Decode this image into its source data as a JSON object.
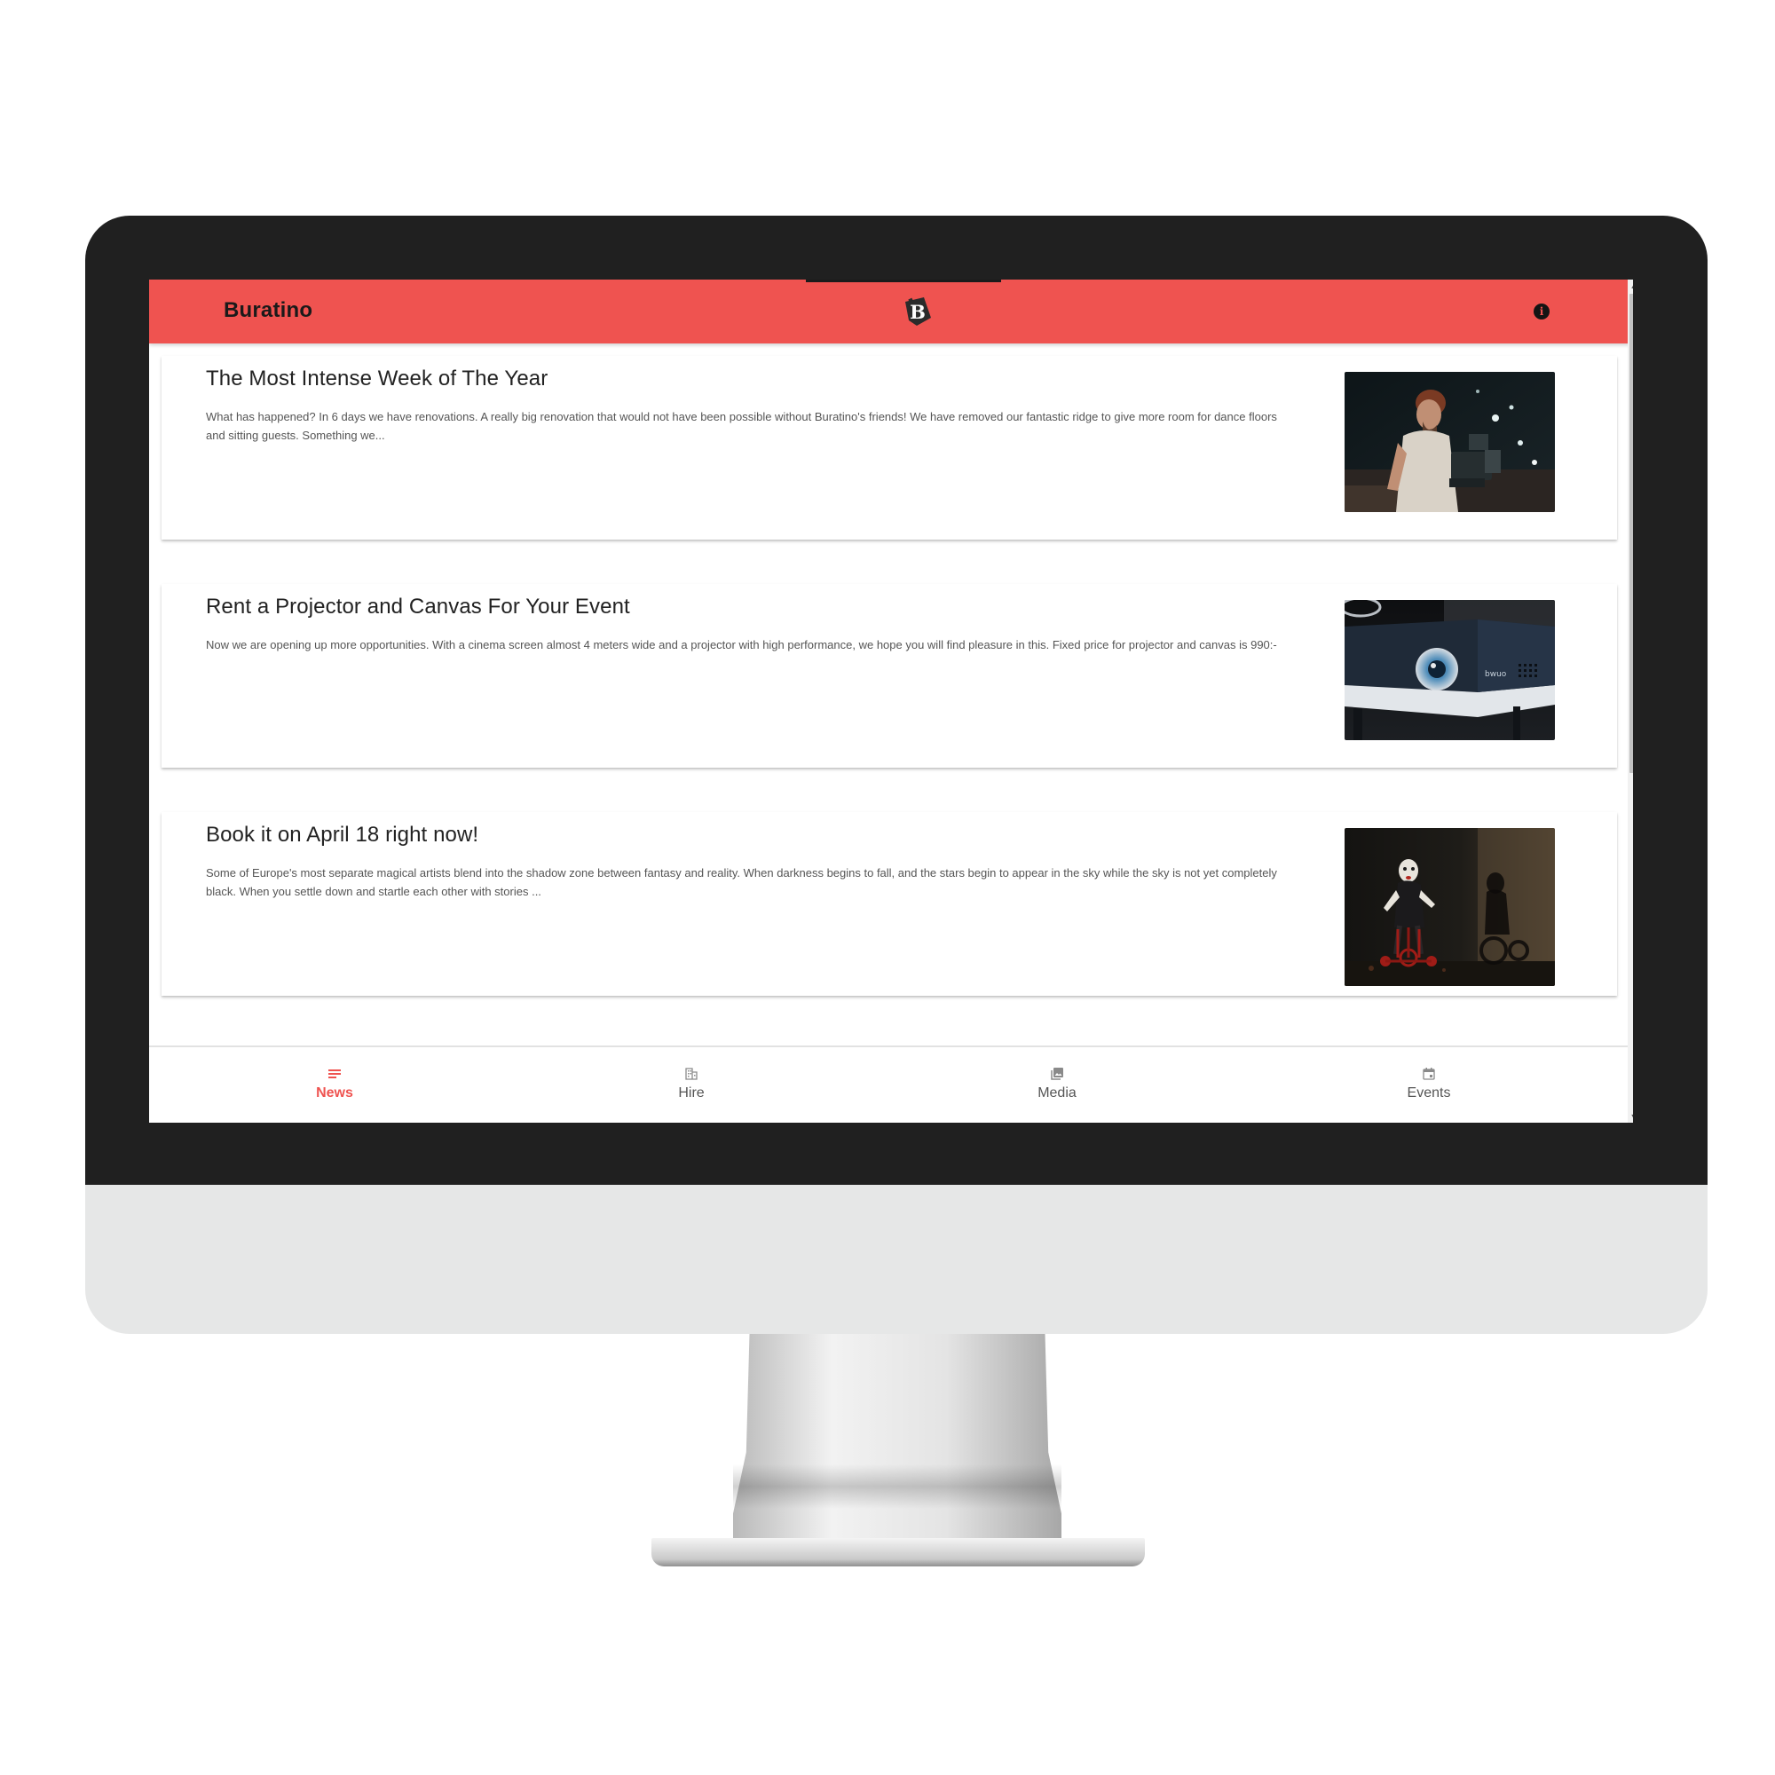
{
  "app": {
    "title": "Buratino",
    "logo_icon": "buratino-logo-icon",
    "info_icon": "info-icon"
  },
  "colors": {
    "accent": "#ef5350",
    "bezel": "#202020",
    "chin": "#e6e7e7"
  },
  "news": [
    {
      "title": "The Most Intense Week of The Year",
      "excerpt": "What has happened? In 6 days we have renovations. A really big renovation that would not have been possible without Buratino's friends! We have removed our fantastic ridge to give more room for dance floors and sitting guests. Something we...",
      "image": "man-with-camera-photo"
    },
    {
      "title": "Rent a Projector and Canvas For Your Event",
      "excerpt": "Now we are opening up more opportunities. With a cinema screen almost 4 meters wide and a projector with high performance, we hope you will find pleasure in this. Fixed price for projector and canvas is 990:-",
      "image": "projector-photo"
    },
    {
      "title": "Book it on April 18 right now!",
      "excerpt": "Some of Europe's most separate magical artists blend into the shadow zone between fantasy and reality. When darkness begins to fall, and the stars begin to appear in the sky while the sky is not yet completely black. When you settle down and startle each other with stories ...",
      "image": "puppet-on-tricycle-photo"
    }
  ],
  "projector_brand": "bwuo",
  "bottom_nav": [
    {
      "label": "News",
      "icon": "list-icon",
      "active": true
    },
    {
      "label": "Hire",
      "icon": "building-icon",
      "active": false
    },
    {
      "label": "Media",
      "icon": "photo-library-icon",
      "active": false
    },
    {
      "label": "Events",
      "icon": "calendar-icon",
      "active": false
    }
  ],
  "scrollbar": {
    "up_arrow": "▲",
    "down_arrow": "▼"
  }
}
